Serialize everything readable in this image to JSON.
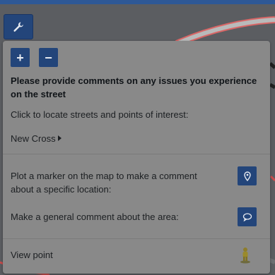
{
  "zoom": {
    "in_label": "+",
    "out_label": "−"
  },
  "panel": {
    "title": "Please provide comments on any issues you experience on the street",
    "locate_prompt": "Click to locate streets and points of interest:",
    "location_link": "New Cross",
    "plot_marker_text": "Plot a marker on the map to make a comment about a specific location:",
    "general_comment_text": "Make a general comment about the area:",
    "view_point_label": "View point"
  },
  "colors": {
    "button": "#23457a",
    "panel": "#898989",
    "topbar": "#2e5896",
    "road": "#c94b4b"
  },
  "icons": {
    "tool_button": "wrench-icon",
    "plot_marker": "map-pin-icon",
    "general_comment": "speech-bubble-icon",
    "view_point": "pegman-icon",
    "location_link": "caret-right-icon"
  }
}
